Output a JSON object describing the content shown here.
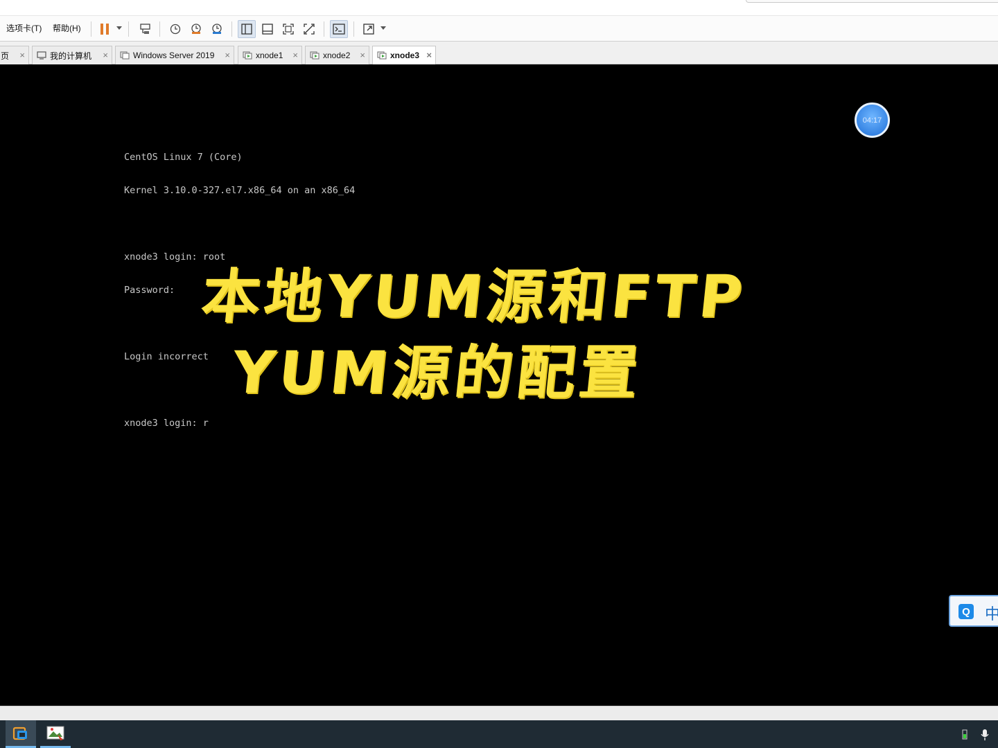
{
  "menu": {
    "tabs_menu": "选项卡(T)",
    "help_menu": "帮助(H)"
  },
  "tabs": [
    {
      "label": "页",
      "active": false
    },
    {
      "label": "我的计算机",
      "active": false
    },
    {
      "label": "Windows Server 2019",
      "active": false
    },
    {
      "label": "xnode1",
      "active": false
    },
    {
      "label": "xnode2",
      "active": false
    },
    {
      "label": "xnode3",
      "active": true
    }
  ],
  "tab_close_glyph": "×",
  "terminal": {
    "lines": [
      "CentOS Linux 7 (Core)",
      "Kernel 3.10.0-327.el7.x86_64 on an x86_64",
      "",
      "xnode3 login: root",
      "Password:",
      "",
      "Login incorrect",
      "",
      "xnode3 login: r"
    ]
  },
  "overlay": {
    "line1": "本地YUM源和FTP",
    "line2": "YUM源的配置"
  },
  "clock": "04:17",
  "ime": {
    "icon_letter": "Q",
    "mode": "中"
  },
  "colors": {
    "overlay_yellow": "#fbe340",
    "terminal_text": "#c8c8c8",
    "accent_blue": "#1d8ae8",
    "pause_orange": "#e07b2a",
    "taskbar": "#1f2b34"
  }
}
